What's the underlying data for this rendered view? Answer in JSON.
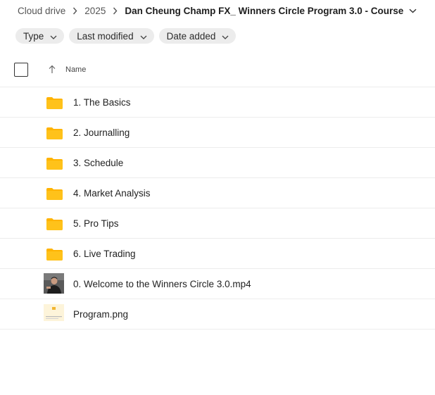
{
  "breadcrumb": {
    "items": [
      "Cloud drive",
      "2025"
    ],
    "current": "Dan Cheung Champ FX_ Winners Circle Program 3.0 - Course"
  },
  "filters": {
    "type": "Type",
    "last_modified": "Last modified",
    "date_added": "Date added"
  },
  "table": {
    "column_name": "Name",
    "sort": "ascending"
  },
  "items": [
    {
      "name": "1. The Basics",
      "kind": "folder"
    },
    {
      "name": "2. Journalling",
      "kind": "folder"
    },
    {
      "name": "3. Schedule",
      "kind": "folder"
    },
    {
      "name": "4. Market Analysis",
      "kind": "folder"
    },
    {
      "name": "5. Pro Tips",
      "kind": "folder"
    },
    {
      "name": "6. Live Trading",
      "kind": "folder"
    },
    {
      "name": "0. Welcome to the Winners Circle 3.0.mp4",
      "kind": "video"
    },
    {
      "name": "Program.png",
      "kind": "image"
    }
  ],
  "colors": {
    "folder": "#ffb300",
    "folder_tab": "#ff9d00",
    "chip_bg": "#ececec",
    "divider": "#ececec"
  }
}
